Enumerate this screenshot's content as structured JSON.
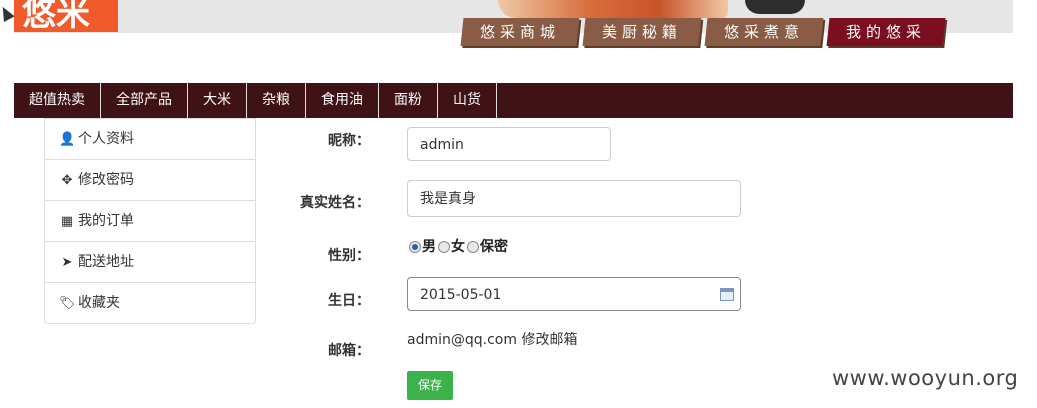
{
  "logo": {
    "text": "悠米"
  },
  "top_tabs": [
    {
      "label": "悠采商城",
      "active": false
    },
    {
      "label": "美厨秘籍",
      "active": false
    },
    {
      "label": "悠采煮意",
      "active": false
    },
    {
      "label": "我的悠采",
      "active": true
    }
  ],
  "main_nav": [
    "超值热卖",
    "全部产品",
    "大米",
    "杂粮",
    "食用油",
    "面粉",
    "山货"
  ],
  "sidebar": [
    {
      "icon": "user-icon",
      "glyph": "👤",
      "label": "个人资料"
    },
    {
      "icon": "move-icon",
      "glyph": "✥",
      "label": "修改密码"
    },
    {
      "icon": "grid-icon",
      "glyph": "▦",
      "label": "我的订单"
    },
    {
      "icon": "send-icon",
      "glyph": "➤",
      "label": "配送地址"
    },
    {
      "icon": "tags-icon",
      "glyph": "🏷",
      "label": "收藏夹"
    }
  ],
  "form": {
    "nickname_label": "昵称：",
    "nickname_value": "admin",
    "realname_label": "真实姓名：",
    "realname_value": "我是真身",
    "gender_label": "性别：",
    "gender_options": [
      "男",
      "女",
      "保密"
    ],
    "gender_selected": "男",
    "birthday_label": "生日：",
    "birthday_value": "2015-05-01",
    "email_label": "邮箱：",
    "email_value": "admin@qq.com",
    "email_change_link": "修改邮箱",
    "save_button": "保存"
  },
  "watermark": "www.wooyun.org",
  "colors": {
    "logo": "#f15a2b",
    "main_nav": "#3f1215",
    "active_tab": "#7b0f20",
    "tab": "#8a5c45",
    "save": "#3cb34a"
  }
}
